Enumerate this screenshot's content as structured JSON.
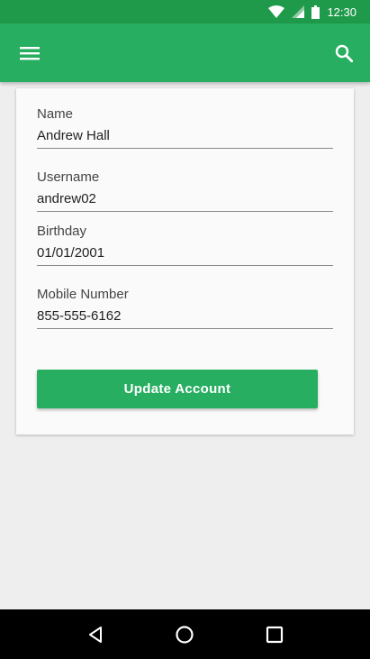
{
  "status_bar": {
    "time": "12:30",
    "icons": [
      "wifi-icon",
      "cell-signal-icon",
      "battery-icon"
    ]
  },
  "app_bar": {
    "menu_icon": "hamburger-menu-icon",
    "search_icon": "search-icon",
    "color": "#27ae60"
  },
  "form": {
    "fields": [
      {
        "label": "Name",
        "value": "Andrew Hall"
      },
      {
        "label": "Username",
        "value": "andrew02"
      },
      {
        "label": "Birthday",
        "value": "01/01/2001"
      },
      {
        "label": "Mobile Number",
        "value": "855-555-6162"
      }
    ],
    "submit_label": "Update Account"
  },
  "nav_bar": {
    "icons": [
      "back-icon",
      "home-icon",
      "recents-icon"
    ]
  }
}
